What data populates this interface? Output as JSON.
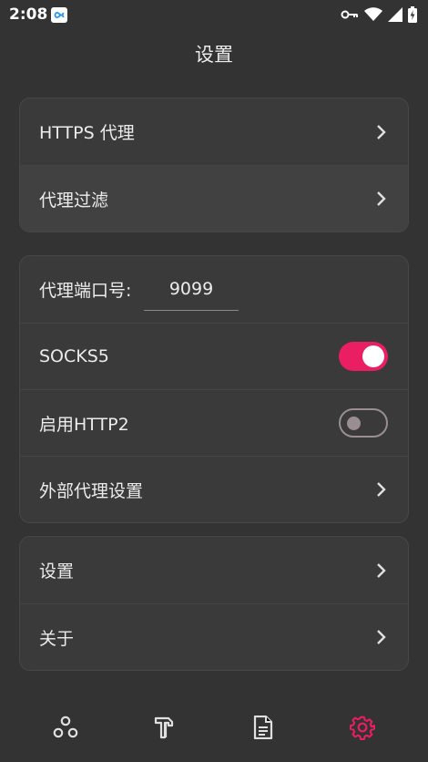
{
  "status_bar": {
    "time": "2:08"
  },
  "header": {
    "title": "设置"
  },
  "card1": {
    "items": [
      {
        "label": "HTTPS 代理"
      },
      {
        "label": "代理过滤"
      }
    ]
  },
  "card2": {
    "port_label": "代理端口号:",
    "port_value": "9099",
    "socks5_label": "SOCKS5",
    "socks5_on": true,
    "http2_label": "启用HTTP2",
    "http2_on": false,
    "external_proxy_label": "外部代理设置"
  },
  "card3": {
    "items": [
      {
        "label": "设置"
      },
      {
        "label": "关于"
      }
    ]
  },
  "bottom_nav": {
    "items": [
      {
        "icon": "network-icon",
        "active": false
      },
      {
        "icon": "tools-icon",
        "active": false
      },
      {
        "icon": "document-icon",
        "active": false
      },
      {
        "icon": "gear-icon",
        "active": true
      }
    ]
  },
  "colors": {
    "background": "#333333",
    "card": "#3A3A3A",
    "accent": "#E91E63",
    "text": "#ECECEC",
    "icon": "#E0E0E0"
  }
}
